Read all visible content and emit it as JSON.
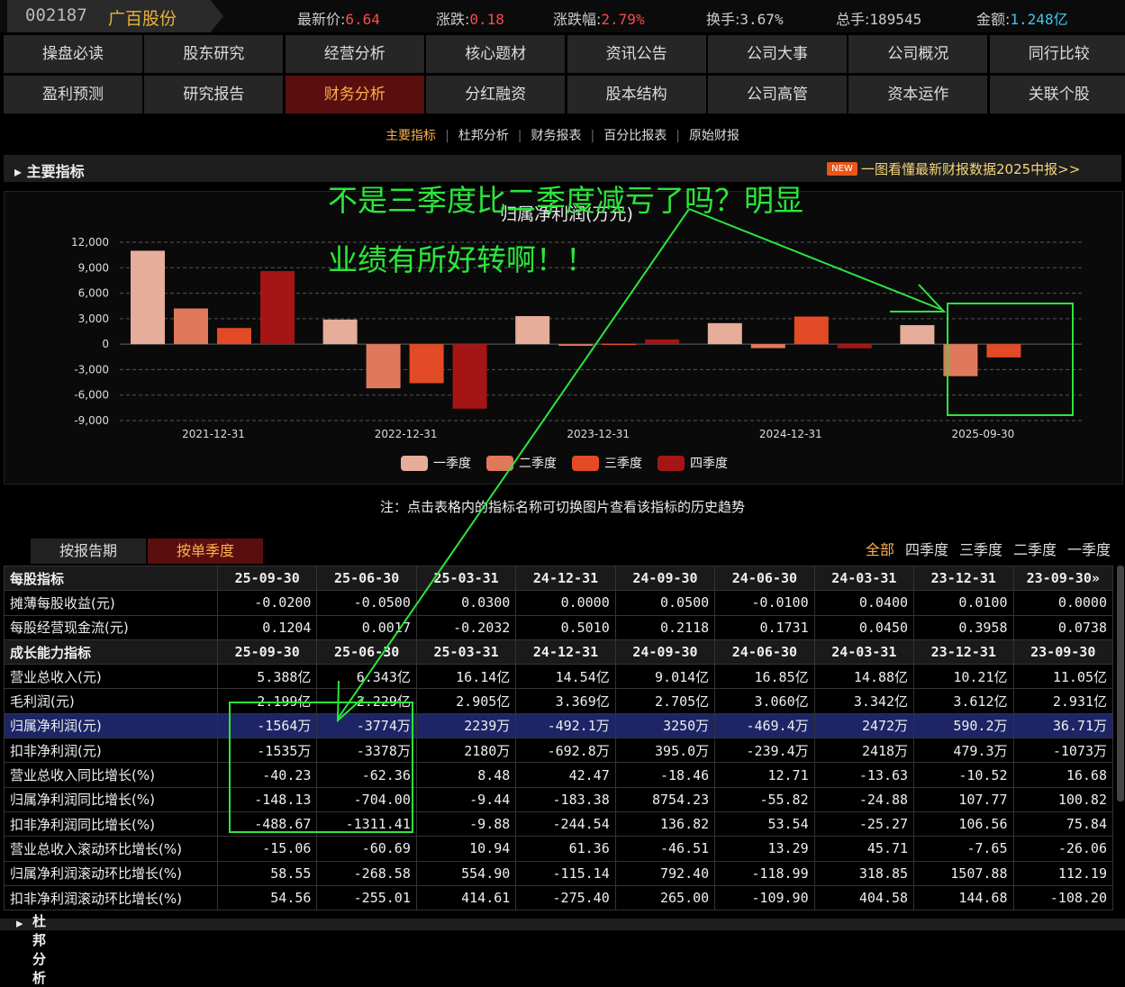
{
  "header": {
    "code": "002187",
    "name": "广百股份",
    "quotes": [
      {
        "label": "最新价:",
        "value": "6.64",
        "color": "red"
      },
      {
        "label": "涨跌:",
        "value": "0.18",
        "color": "red"
      },
      {
        "label": "涨跌幅:",
        "value": "2.79%",
        "color": "red"
      },
      {
        "label": "换手:",
        "value": "3.67%",
        "color": ""
      },
      {
        "label": "总手:",
        "value": "189545",
        "color": ""
      },
      {
        "label": "金额:",
        "value": "1.248亿",
        "color": "cyan"
      }
    ]
  },
  "nav_row1": [
    "操盘必读",
    "股东研究",
    "经营分析",
    "核心题材",
    "资讯公告",
    "公司大事",
    "公司概况",
    "同行比较"
  ],
  "nav_row2": [
    "盈利预测",
    "研究报告",
    "财务分析",
    "分红融资",
    "股本结构",
    "公司高管",
    "资本运作",
    "关联个股"
  ],
  "nav_active": "财务分析",
  "subtabs": [
    "主要指标",
    "杜邦分析",
    "财务报表",
    "百分比报表",
    "原始财报"
  ],
  "subtab_active": "主要指标",
  "section": {
    "title": "主要指标",
    "new_badge": "NEW",
    "link": "一图看懂最新财报数据2025中报>>"
  },
  "annotation": {
    "line1": "不是三季度比二季度减亏了吗？明显",
    "line2": "业绩有所好转啊！！"
  },
  "chart_data": {
    "type": "bar",
    "title": "归属净利润(万元)",
    "ylim": [
      -9000,
      12000
    ],
    "yticks": [
      12000,
      9000,
      6000,
      3000,
      0,
      -3000,
      -6000,
      -9000
    ],
    "ytick_labels": [
      "12,000",
      "9,000",
      "6,000",
      "3,000",
      "0",
      "-3,000",
      "-6,000",
      "-9,000"
    ],
    "x_labels": [
      "2021-12-31",
      "2022-12-31",
      "2023-12-31",
      "2024-12-31",
      "2025-09-30"
    ],
    "categories": [
      "2021",
      "2022",
      "2023",
      "2024",
      "2025"
    ],
    "series": [
      {
        "name": "一季度",
        "color": "#e6ad9a",
        "values": [
          11000,
          2900,
          3300,
          2472,
          2239
        ]
      },
      {
        "name": "二季度",
        "color": "#e0795c",
        "values": [
          4200,
          -5200,
          -200,
          -469.4,
          -3774
        ]
      },
      {
        "name": "三季度",
        "color": "#e24b25",
        "values": [
          1900,
          -4600,
          50,
          3250,
          -1564
        ]
      },
      {
        "name": "四季度",
        "color": "#a51515",
        "values": [
          8600,
          -7600,
          560,
          -492.1,
          null
        ]
      }
    ],
    "grid": true,
    "legend": "bottom"
  },
  "note": "注：点击表格内的指标名称可切换图片查看该指标的历史趋势",
  "table_tabs": [
    "按报告期",
    "按单季度"
  ],
  "table_tab_active": "按单季度",
  "filters": [
    "全部",
    "四季度",
    "三季度",
    "二季度",
    "一季度"
  ],
  "filter_active": "全部",
  "table": {
    "rows": [
      {
        "type": "head",
        "name": "每股指标",
        "cells": [
          "25-09-30",
          "25-06-30",
          "25-03-31",
          "24-12-31",
          "24-09-30",
          "24-06-30",
          "24-03-31",
          "23-12-31",
          "23-09-30»"
        ]
      },
      {
        "name": "摊薄每股收益(元)",
        "cells": [
          "-0.0200",
          "-0.0500",
          "0.0300",
          "0.0000",
          "0.0500",
          "-0.0100",
          "0.0400",
          "0.0100",
          "0.0000"
        ]
      },
      {
        "name": "每股经营现金流(元)",
        "cells": [
          "0.1204",
          "0.0017",
          "-0.2032",
          "0.5010",
          "0.2118",
          "0.1731",
          "0.0450",
          "0.3958",
          "0.0738"
        ]
      },
      {
        "type": "head",
        "name": "成长能力指标",
        "cells": [
          "25-09-30",
          "25-06-30",
          "25-03-31",
          "24-12-31",
          "24-09-30",
          "24-06-30",
          "24-03-31",
          "23-12-31",
          "23-09-30"
        ]
      },
      {
        "name": "营业总收入(元)",
        "cells": [
          "5.388亿",
          "6.343亿",
          "16.14亿",
          "14.54亿",
          "9.014亿",
          "16.85亿",
          "14.88亿",
          "10.21亿",
          "11.05亿"
        ]
      },
      {
        "name": "毛利润(元)",
        "cells": [
          "2.199亿",
          "2.229亿",
          "2.905亿",
          "3.369亿",
          "2.705亿",
          "3.060亿",
          "3.342亿",
          "3.612亿",
          "2.931亿"
        ]
      },
      {
        "type": "sel",
        "name": "归属净利润(元)",
        "cells": [
          "-1564万",
          "-3774万",
          "2239万",
          "-492.1万",
          "3250万",
          "-469.4万",
          "2472万",
          "590.2万",
          "36.71万"
        ]
      },
      {
        "name": "扣非净利润(元)",
        "cells": [
          "-1535万",
          "-3378万",
          "2180万",
          "-692.8万",
          "395.0万",
          "-239.4万",
          "2418万",
          "479.3万",
          "-1073万"
        ]
      },
      {
        "name": "营业总收入同比增长(%)",
        "cells": [
          "-40.23",
          "-62.36",
          "8.48",
          "42.47",
          "-18.46",
          "12.71",
          "-13.63",
          "-10.52",
          "16.68"
        ]
      },
      {
        "name": "归属净利润同比增长(%)",
        "cells": [
          "-148.13",
          "-704.00",
          "-9.44",
          "-183.38",
          "8754.23",
          "-55.82",
          "-24.88",
          "107.77",
          "100.82"
        ]
      },
      {
        "name": "扣非净利润同比增长(%)",
        "cells": [
          "-488.67",
          "-1311.41",
          "-9.88",
          "-244.54",
          "136.82",
          "53.54",
          "-25.27",
          "106.56",
          "75.84"
        ]
      },
      {
        "name": "营业总收入滚动环比增长(%)",
        "cells": [
          "-15.06",
          "-60.69",
          "10.94",
          "61.36",
          "-46.51",
          "13.29",
          "45.71",
          "-7.65",
          "-26.06"
        ]
      },
      {
        "name": "归属净利润滚动环比增长(%)",
        "cells": [
          "58.55",
          "-268.58",
          "554.90",
          "-115.14",
          "792.40",
          "-118.99",
          "318.85",
          "1507.88",
          "112.19"
        ]
      },
      {
        "name": "扣非净利润滚动环比增长(%)",
        "cells": [
          "54.56",
          "-255.01",
          "414.61",
          "-275.40",
          "265.00",
          "-109.90",
          "404.58",
          "144.68",
          "-108.20"
        ]
      }
    ]
  },
  "bottom_section": "杜邦分析"
}
